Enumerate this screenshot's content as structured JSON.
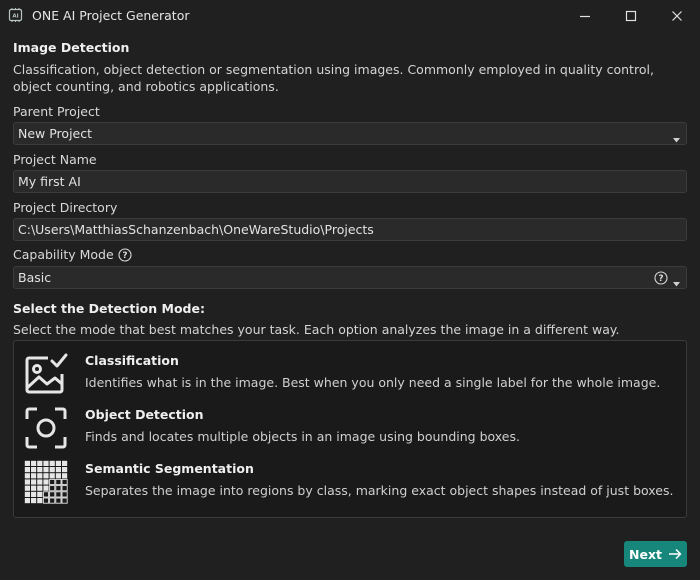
{
  "window": {
    "title": "ONE AI Project Generator",
    "app_icon": "ai-chip-icon",
    "controls": [
      "minimize-icon",
      "maximize-icon",
      "close-icon"
    ]
  },
  "intro": {
    "heading": "Image Detection",
    "description": "Classification, object detection or segmentation using images. Commonly employed in quality control, object counting, and robotics applications."
  },
  "fields": {
    "parent_project": {
      "label": "Parent Project",
      "value": "New Project"
    },
    "project_name": {
      "label": "Project Name",
      "value": "My first AI"
    },
    "project_directory": {
      "label": "Project Directory",
      "value": "C:\\Users\\MatthiasSchanzenbach\\OneWareStudio\\Projects"
    },
    "capability_mode": {
      "label": "Capability Mode",
      "value": "Basic"
    }
  },
  "detection": {
    "heading": "Select the Detection Mode:",
    "description": "Select the mode that best matches your task. Each option analyzes the image in a different way.",
    "modes": [
      {
        "title": "Classification",
        "description": "Identifies what is in the image. Best when you only need a single label for the whole image.",
        "icon": "image-check-icon"
      },
      {
        "title": "Object Detection",
        "description": "Finds and locates multiple objects in an image using bounding boxes.",
        "icon": "focus-target-icon"
      },
      {
        "title": "Semantic Segmentation",
        "description": "Separates the image into regions by class, marking exact object shapes instead of just boxes.",
        "icon": "grid-segmentation-icon"
      }
    ]
  },
  "footer": {
    "next_label": "Next",
    "accent_color": "#16877a"
  }
}
